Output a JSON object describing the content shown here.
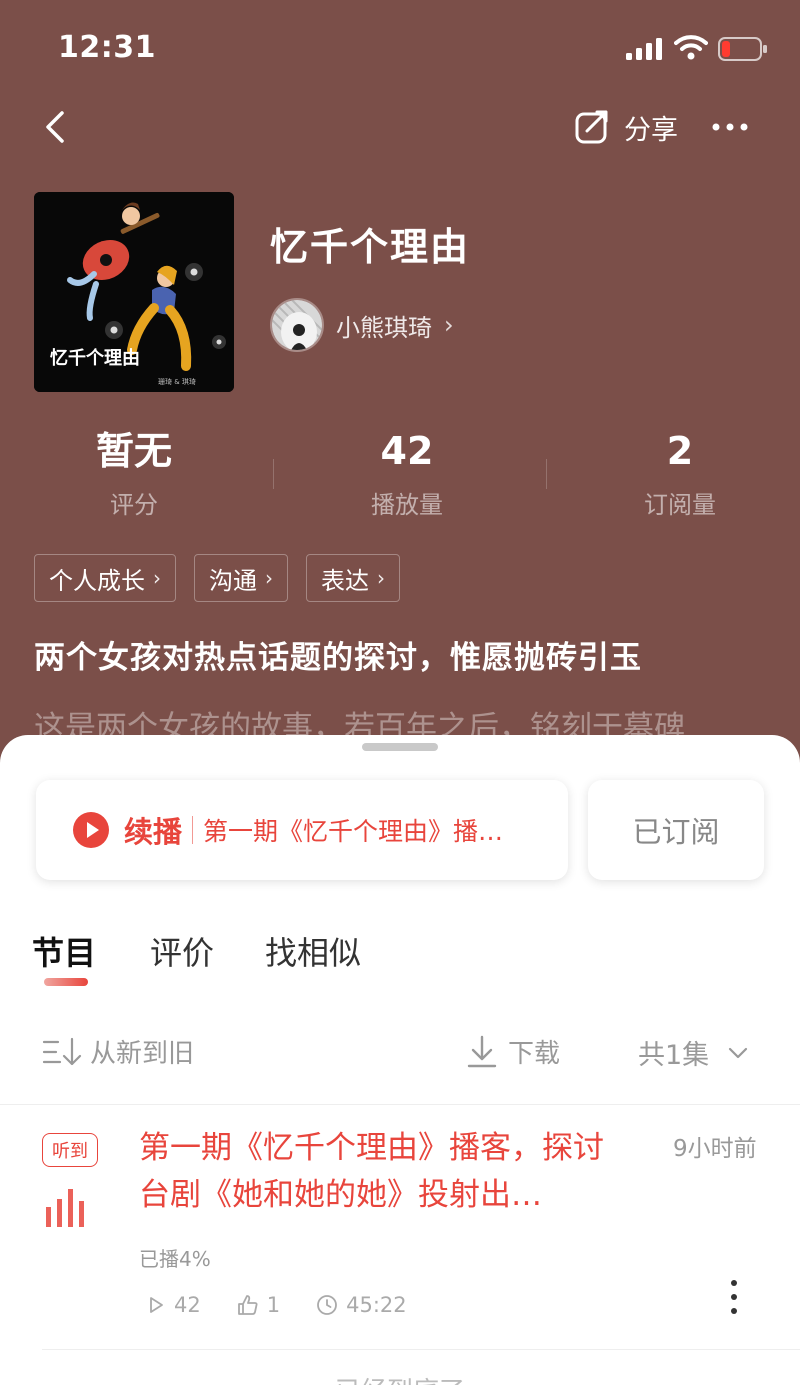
{
  "status_bar": {
    "time": "12:31"
  },
  "nav": {
    "share_label": "分享"
  },
  "album": {
    "title": "忆千个理由",
    "author": "小熊琪琦",
    "cover_text": "忆千个理由",
    "cover_subtext": "珊琦 & 琪琦"
  },
  "stats": [
    {
      "value": "暂无",
      "label": "评分"
    },
    {
      "value": "42",
      "label": "播放量"
    },
    {
      "value": "2",
      "label": "订阅量"
    }
  ],
  "tags": [
    "个人成长",
    "沟通",
    "表达"
  ],
  "tagline": "两个女孩对热点话题的探讨，惟愿抛砖引玉",
  "description": "这是两个女孩的故事，若百年之后，铭刻于墓碑",
  "resume": {
    "label": "续播",
    "episode": "第一期《忆千个理由》播…"
  },
  "subscribed_label": "已订阅",
  "tabs": [
    "节目",
    "评价",
    "找相似"
  ],
  "sort_label": "从新到旧",
  "download_label": "下载",
  "count_label": "共1集",
  "episode": {
    "badge": "听到",
    "title": "第一期《忆千个理由》播客，探讨台剧《她和她的她》投射出…",
    "time_ago": "9小时前",
    "progress_text": "已播4%",
    "plays": "42",
    "likes": "1",
    "duration": "45:22"
  },
  "end_text": "已经到底了",
  "colors": {
    "accent": "#e8453c",
    "header_bg": "#7b4f49"
  }
}
